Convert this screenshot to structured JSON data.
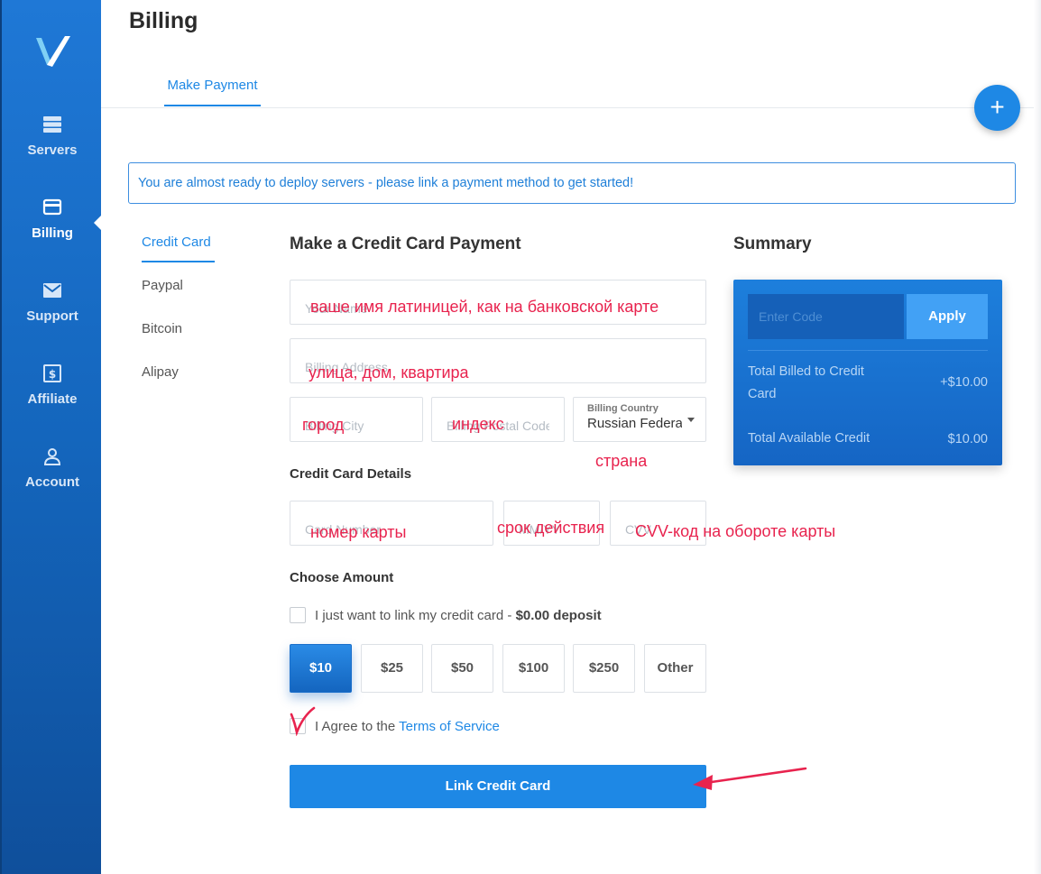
{
  "header": {
    "title": "Billing",
    "tab": "Make Payment",
    "fab_label": "+"
  },
  "sidebar": {
    "items": [
      {
        "label": "Servers",
        "icon": "servers-icon"
      },
      {
        "label": "Billing",
        "icon": "credit-card-icon"
      },
      {
        "label": "Support",
        "icon": "envelope-icon"
      },
      {
        "label": "Affiliate",
        "icon": "dollar-icon"
      },
      {
        "label": "Account",
        "icon": "user-icon"
      }
    ],
    "active": "Billing"
  },
  "alert": "You are almost ready to deploy servers - please link a payment method to get started!",
  "methods": [
    "Credit Card",
    "Paypal",
    "Bitcoin",
    "Alipay"
  ],
  "form": {
    "title": "Make a Credit Card Payment",
    "name_placeholder": "Your Name",
    "address_placeholder": "Billing Address",
    "city_placeholder": "Billing City",
    "postal_placeholder": "Billing Postal Code",
    "country_label": "Billing Country",
    "country_value": "Russian Federation",
    "card_section": "Credit Card Details",
    "card_number_placeholder": "Card Number",
    "expiry_placeholder": "MM/YY",
    "cvv_placeholder": "CVV",
    "amount_section": "Choose Amount",
    "link_only_label": "I just want to link my credit card -",
    "link_only_bold": "$0.00 deposit",
    "amounts": [
      "$10",
      "$25",
      "$50",
      "$100",
      "$250",
      "Other"
    ],
    "selected_amount": "$10",
    "agree_label": "I Agree to the",
    "terms_link": "Terms of Service",
    "submit": "Link Credit Card"
  },
  "annotations": {
    "name": "ваше имя латиницей, как на банковской карте",
    "address": "улица, дом, квартира",
    "city": "город",
    "postal": "индекс",
    "country": "страна",
    "card_number": "номер карты",
    "expiry": "срок действия",
    "cvv": "CVV-код на обороте карты",
    "color": "#e8234e"
  },
  "summary": {
    "title": "Summary",
    "code_placeholder": "Enter Code",
    "apply": "Apply",
    "billed_label": "Total Billed to Credit Card",
    "billed_value": "+$10.00",
    "available_label": "Total Available Credit",
    "available_value": "$10.00"
  },
  "colors": {
    "accent": "#1e88e5",
    "sidebar": "#1466bd"
  }
}
